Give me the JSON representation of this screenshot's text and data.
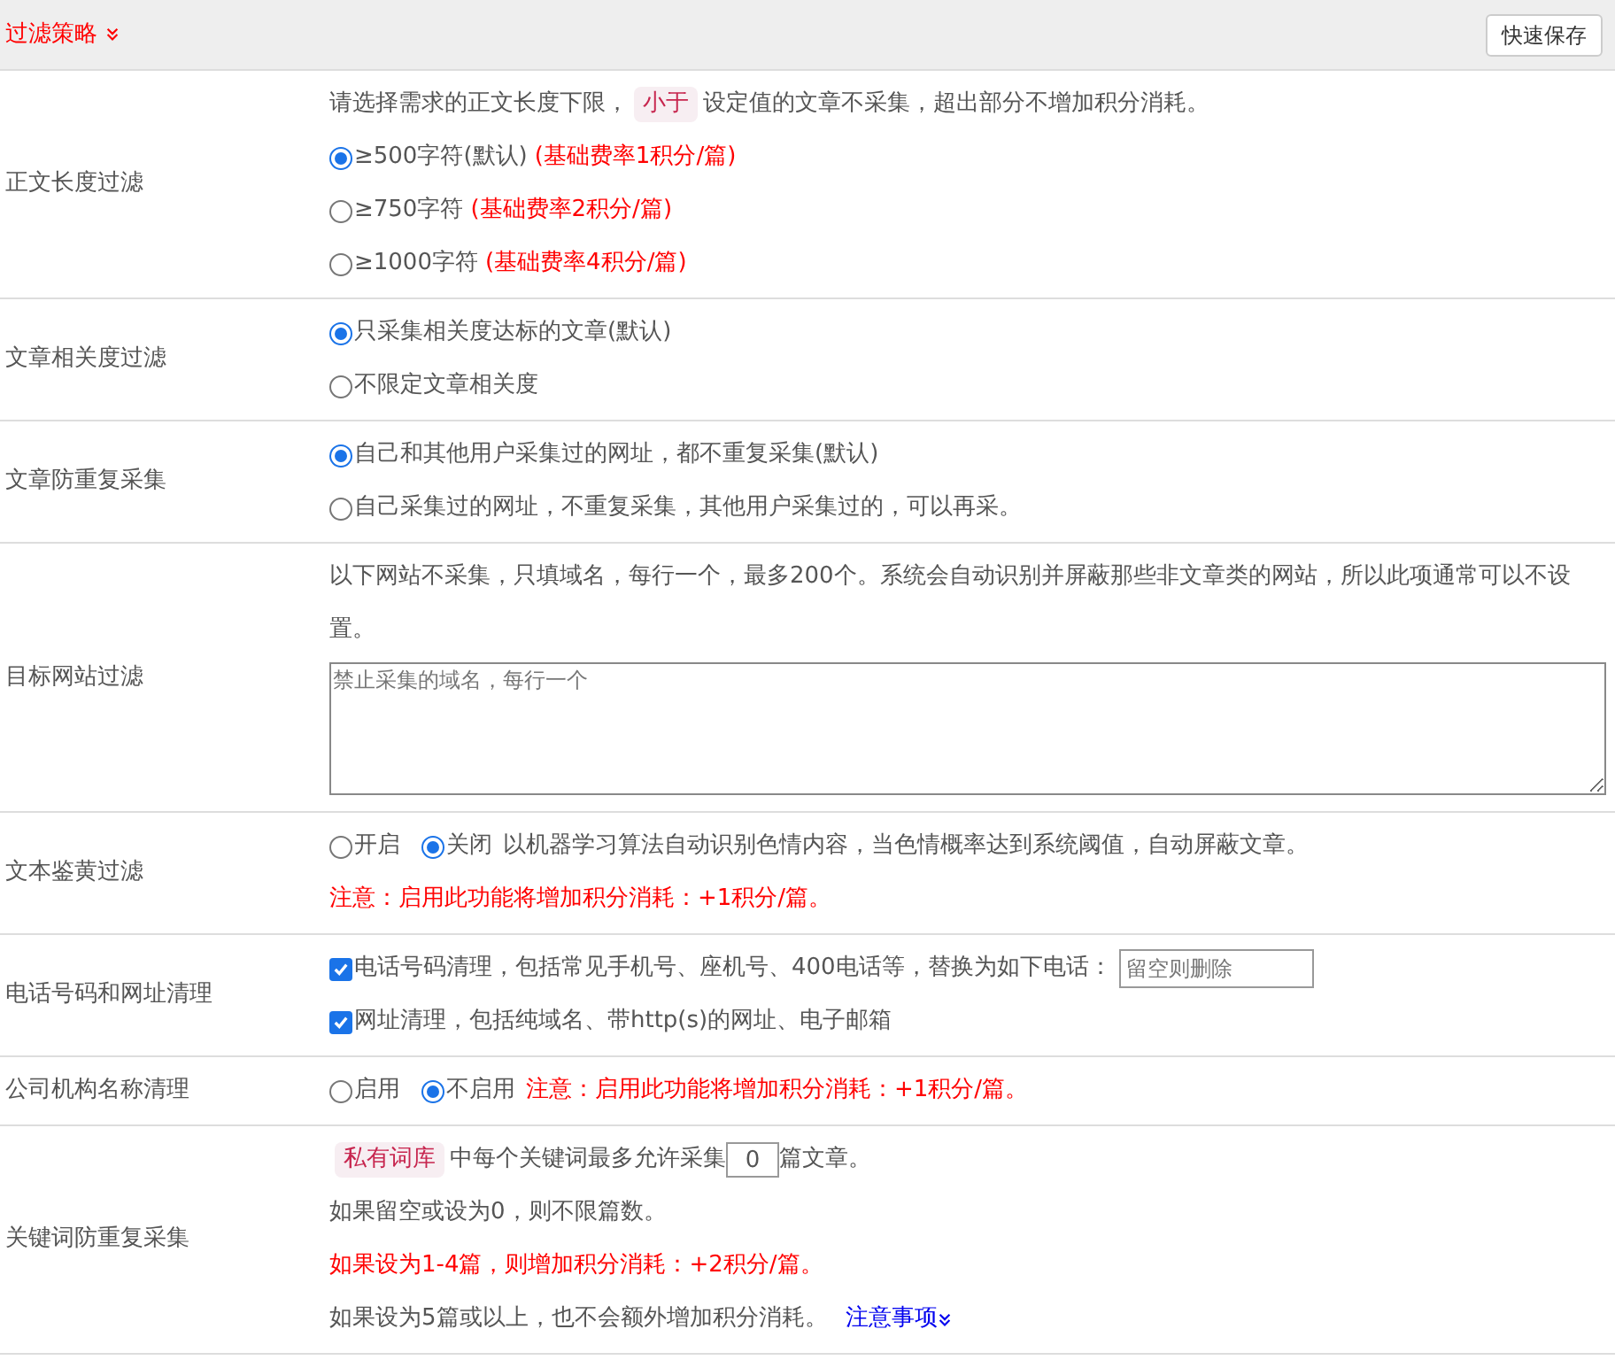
{
  "header": {
    "title": "过滤策略",
    "save_button": "快速保存"
  },
  "rows": [
    {
      "label": "正文长度过滤",
      "lines": [
        {
          "kind": "tagged",
          "before": "请选择需求的正文长度下限，",
          "tag": "小于",
          "after": "设定值的文章不采集，超出部分不增加积分消耗。"
        },
        {
          "kind": "radio",
          "label": "≥500字符(默认)",
          "note": "(基础费率1积分/篇)",
          "selected": true
        },
        {
          "kind": "radio",
          "label": "≥750字符",
          "note": "(基础费率2积分/篇)",
          "selected": false
        },
        {
          "kind": "radio",
          "label": "≥1000字符",
          "note": "(基础费率4积分/篇)",
          "selected": false
        }
      ]
    },
    {
      "label": "文章相关度过滤",
      "lines": [
        {
          "kind": "radio",
          "label": "只采集相关度达标的文章(默认)",
          "selected": true
        },
        {
          "kind": "radio",
          "label": "不限定文章相关度",
          "selected": false
        }
      ]
    },
    {
      "label": "文章防重复采集",
      "lines": [
        {
          "kind": "radio",
          "label": "自己和其他用户采集过的网址，都不重复采集(默认)",
          "selected": true
        },
        {
          "kind": "radio",
          "label": "自己采集过的网址，不重复采集，其他用户采集过的，可以再采。",
          "selected": false
        }
      ]
    },
    {
      "label": "目标网站过滤",
      "lines": [
        {
          "kind": "text",
          "text": "以下网站不采集，只填域名，每行一个，最多200个。系统会自动识别并屏蔽那些非文章类的网站，所以此项通常可以不设置。"
        },
        {
          "kind": "textarea",
          "placeholder": "禁止采集的域名，每行一个"
        }
      ]
    },
    {
      "label": "文本鉴黄过滤",
      "lines": [
        {
          "kind": "inline_radios",
          "options": [
            {
              "label": "开启",
              "selected": false
            },
            {
              "label": "关闭",
              "selected": true
            }
          ],
          "text": "以机器学习算法自动识别色情内容，当色情概率达到系统阈值，自动屏蔽文章。"
        },
        {
          "kind": "warning",
          "text": "注意：启用此功能将增加积分消耗：+1积分/篇。"
        }
      ]
    },
    {
      "label": "电话号码和网址清理",
      "lines": [
        {
          "kind": "checkbox",
          "label": "电话号码清理，包括常见手机号、座机号、400电话等，替换为如下电话：",
          "checked": true,
          "placeholder": "留空则删除"
        },
        {
          "kind": "checkbox",
          "label": "网址清理，包括纯域名、带http(s)的网址、电子邮箱",
          "checked": true
        }
      ]
    },
    {
      "label": "公司机构名称清理",
      "lines": [
        {
          "kind": "inline_radios",
          "options": [
            {
              "label": "启用",
              "selected": false
            },
            {
              "label": "不启用",
              "selected": true
            }
          ],
          "warning": "注意：启用此功能将增加积分消耗：+1积分/篇。"
        }
      ]
    },
    {
      "label": "关键词防重复采集",
      "lines": [
        {
          "kind": "count",
          "tag": "私有词库",
          "before": "中每个关键词最多允许采集",
          "value": "0",
          "after": "篇文章。"
        },
        {
          "kind": "text",
          "text": "如果留空或设为0，则不限篇数。"
        },
        {
          "kind": "warning",
          "text": "如果设为1-4篇，则增加积分消耗：+2积分/篇。"
        },
        {
          "kind": "link_text",
          "text": "如果设为5篇或以上，也不会额外增加积分消耗。",
          "link": "注意事项"
        }
      ]
    }
  ]
}
